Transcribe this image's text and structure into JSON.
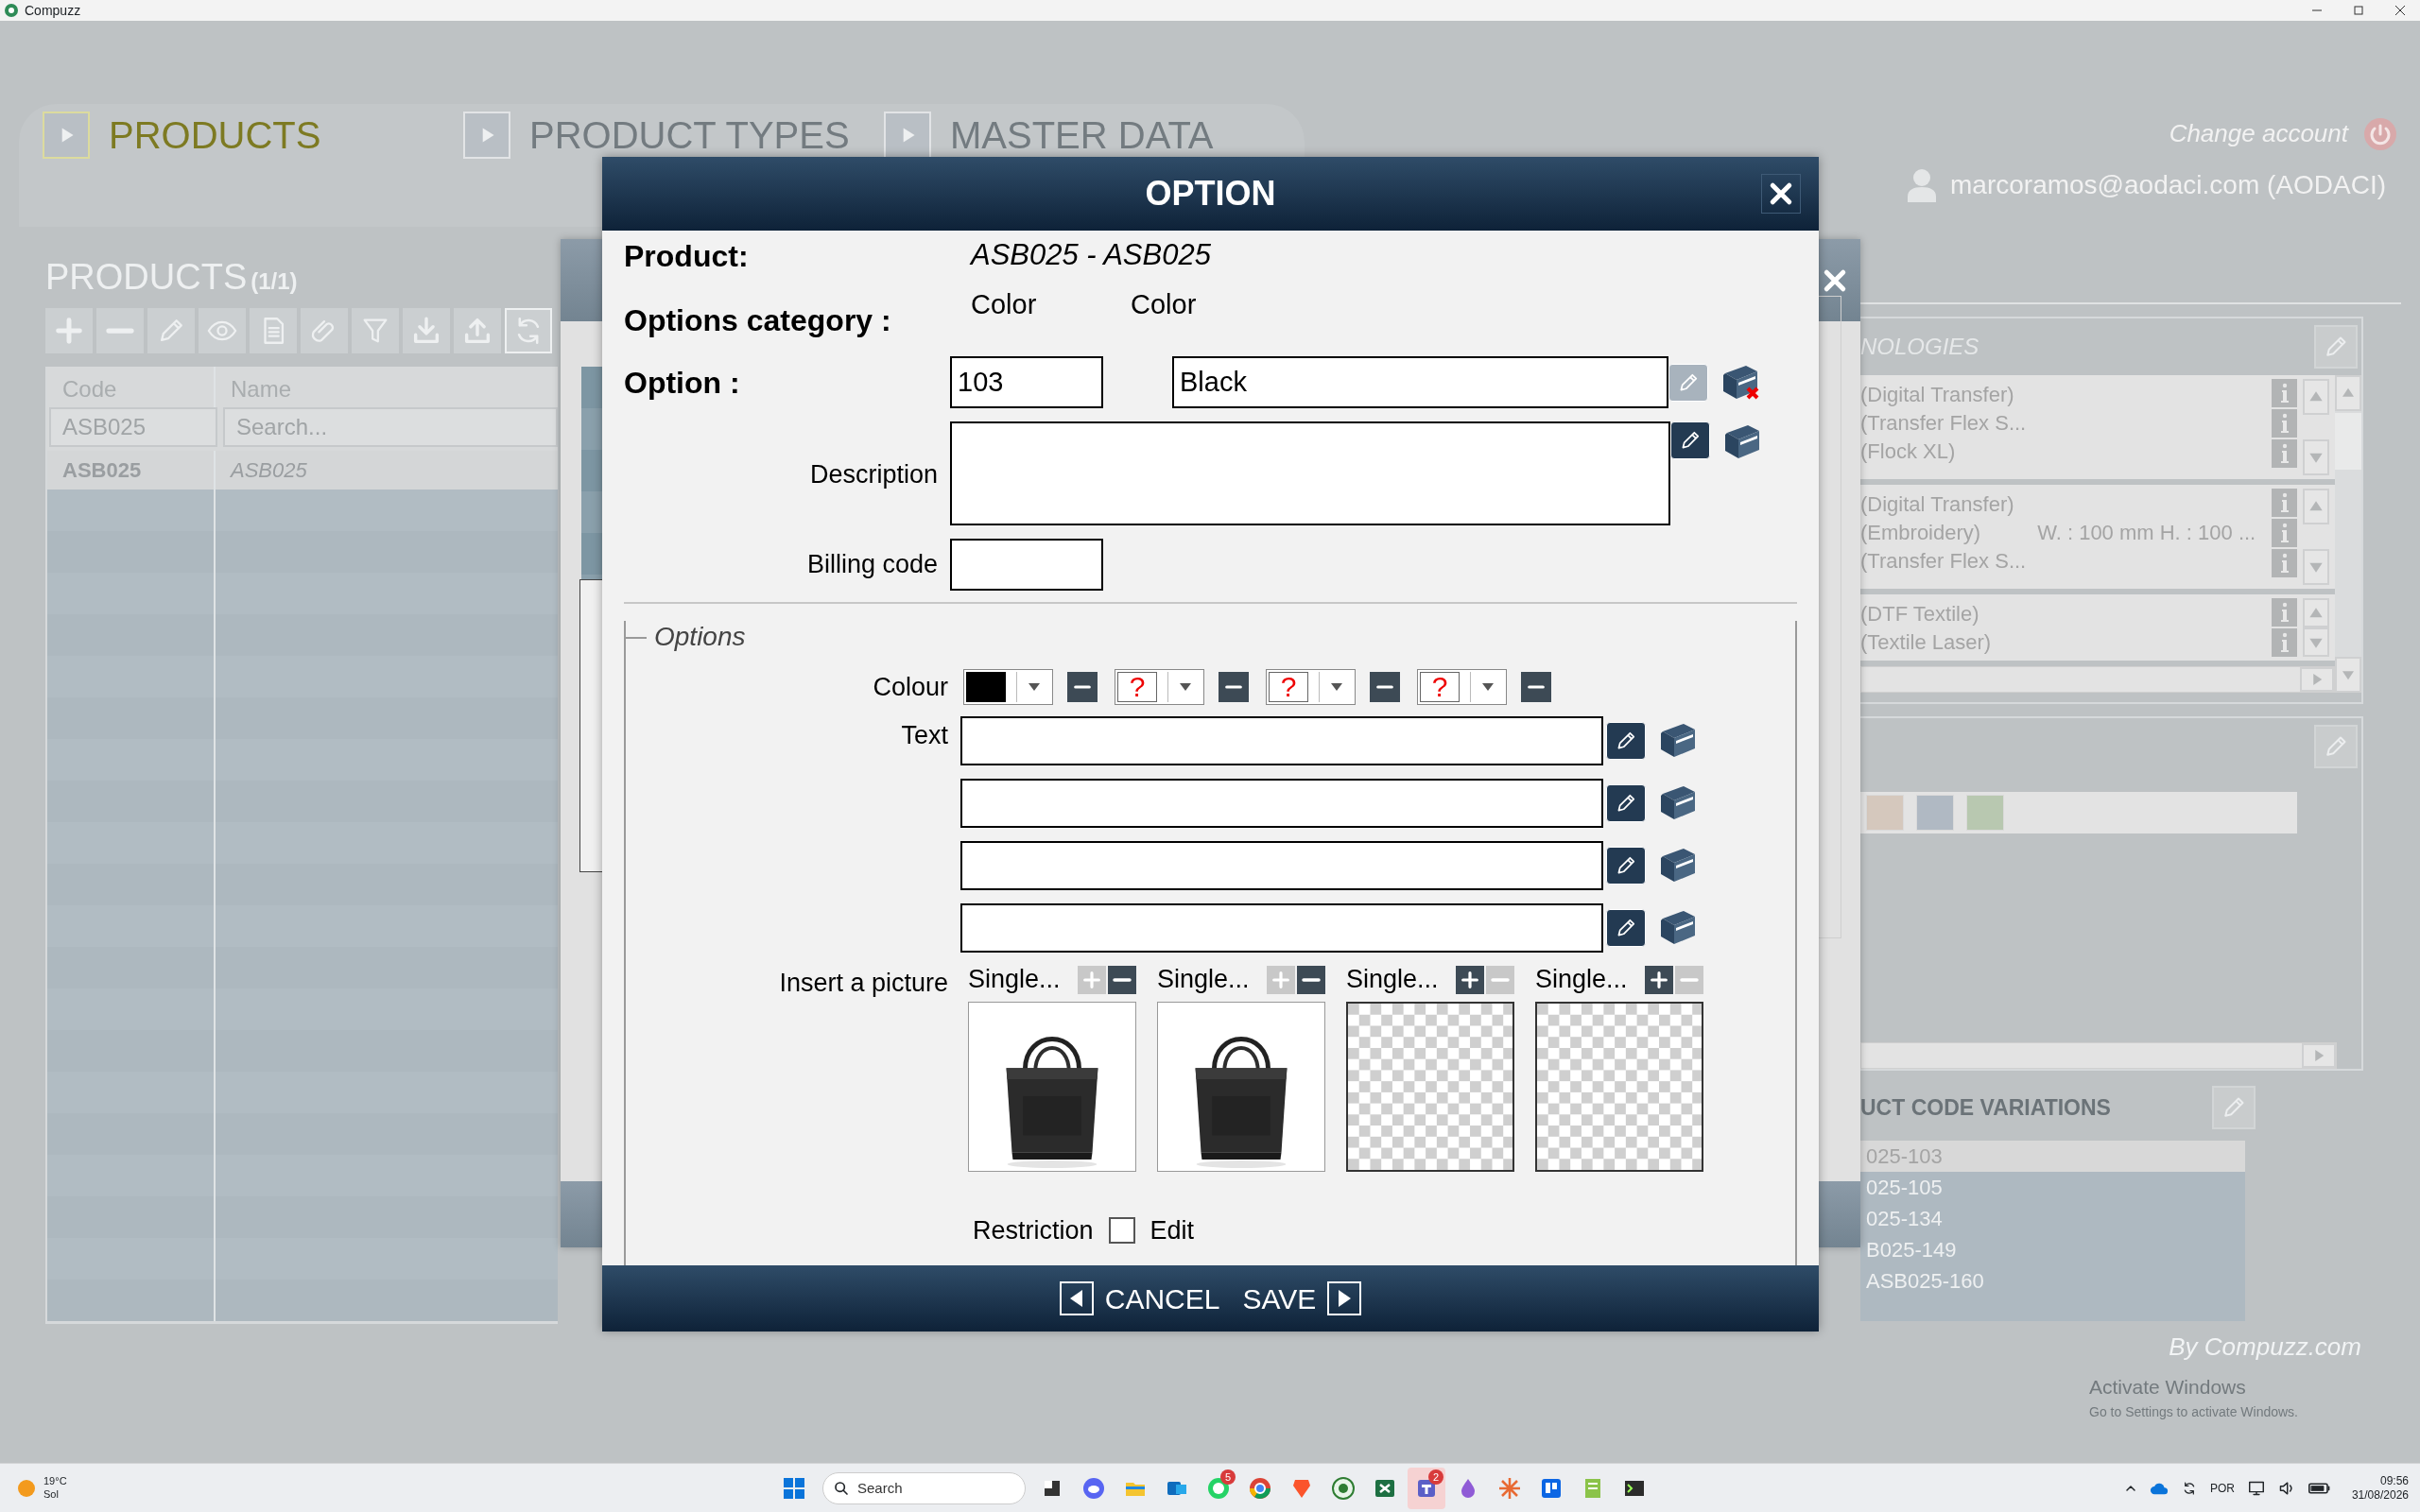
{
  "window": {
    "title": "Compuzz"
  },
  "nav_tabs": [
    {
      "label": "PRODUCTS",
      "selected": true
    },
    {
      "label": "PRODUCT TYPES",
      "selected": false
    },
    {
      "label": "MASTER DATA",
      "selected": false
    }
  ],
  "account": {
    "change_label": "Change account",
    "user": "marcoramos@aodaci.com (AODACI)"
  },
  "products_panel": {
    "title": "PRODUCTS",
    "count": "(1/1)",
    "toolbar": [
      {
        "kind": "add",
        "focused": false
      },
      {
        "kind": "remove",
        "focused": false
      },
      {
        "kind": "edit",
        "focused": false
      },
      {
        "kind": "view",
        "focused": false
      },
      {
        "kind": "document",
        "focused": false
      },
      {
        "kind": "attach",
        "focused": false
      },
      {
        "kind": "filter",
        "focused": false
      },
      {
        "kind": "download",
        "focused": false
      },
      {
        "kind": "upload",
        "focused": false
      },
      {
        "kind": "refresh",
        "focused": true
      }
    ],
    "columns": [
      "Code",
      "Name"
    ],
    "filters": [
      {
        "value": "ASB025"
      },
      {
        "placeholder": "Search..."
      }
    ],
    "rows": [
      {
        "code": "ASB025",
        "name": "ASB025"
      }
    ]
  },
  "technologies_panel": {
    "title": "NOLOGIES",
    "groups": [
      {
        "lines": [
          {
            "text": "(Digital Transfer)"
          },
          {
            "text": "(Transfer Flex S..."
          },
          {
            "text": "(Flock XL)"
          }
        ]
      },
      {
        "lines": [
          {
            "text": "(Digital Transfer)"
          },
          {
            "text": "(Embroidery)",
            "size": "W. : 100 mm H. : 100 ..."
          },
          {
            "text": "(Transfer Flex S..."
          }
        ]
      },
      {
        "lines": [
          {
            "text": "(DTF Textile)"
          },
          {
            "text": "(Textile Laser)"
          }
        ]
      }
    ]
  },
  "colors_panel": {
    "swatches": [
      {
        "color": "#d5c8bd"
      },
      {
        "color": "#b0b9c3"
      },
      {
        "color": "#b8c8b0"
      }
    ]
  },
  "variations_panel": {
    "title": "UCT CODE VARIATIONS",
    "rows": [
      {
        "code": "025-103",
        "selected": true
      },
      {
        "code": "025-105",
        "selected": false
      },
      {
        "code": "025-134",
        "selected": false
      },
      {
        "code": "B025-149",
        "selected": false
      },
      {
        "code": "ASB025-160",
        "selected": false
      }
    ]
  },
  "footer": {
    "brand": "By Compuzz.com"
  },
  "activation_notice": {
    "title": "Activate Windows",
    "text": "Go to Settings to activate Windows."
  },
  "dialog": {
    "title": "OPTION",
    "product_label": "Product:",
    "product_value": "ASB025 - ASB025",
    "category_label": "Options category :",
    "category_values": [
      "Color",
      "Color"
    ],
    "option_label": "Option :",
    "option_code": "103",
    "option_name": "Black",
    "option_edit_disabled": true,
    "option_flagged": true,
    "description_label": "Description",
    "description_edit_disabled": false,
    "description_flagged": false,
    "billing_label": "Billing code",
    "options_legend": "Options",
    "colour_label": "Colour",
    "colour_slots": [
      {
        "kind": "swatch",
        "color": "#000000"
      },
      {
        "kind": "unknown",
        "symbol": "?"
      },
      {
        "kind": "unknown",
        "symbol": "?"
      },
      {
        "kind": "unknown",
        "symbol": "?"
      }
    ],
    "text_label": "Text",
    "text_rows": [
      {
        "edit_disabled": false
      },
      {
        "edit_disabled": false
      },
      {
        "edit_disabled": false
      },
      {
        "edit_disabled": false
      }
    ],
    "picture_label": "Insert a picture",
    "pictures": [
      {
        "label": "Single...",
        "kind": "picture",
        "add_enabled": false,
        "remove_enabled": true
      },
      {
        "label": "Single...",
        "kind": "picture",
        "add_enabled": false,
        "remove_enabled": true
      },
      {
        "label": "Single...",
        "kind": "empty",
        "add_enabled": true,
        "remove_enabled": false
      },
      {
        "label": "Single...",
        "kind": "empty",
        "add_enabled": true,
        "remove_enabled": false
      }
    ],
    "restriction_label": "Restriction",
    "restriction_checked": false,
    "edit_label": "Edit",
    "buttons": [
      {
        "label": "CANCEL",
        "kind": "back"
      },
      {
        "label": "SAVE",
        "kind": "forward"
      }
    ]
  },
  "taskbar": {
    "temperature": "19°C",
    "weather": "Sol",
    "search_placeholder": "Search",
    "apps": [
      {
        "active": false
      },
      {
        "active": false
      },
      {
        "active": false
      },
      {
        "active": false
      },
      {
        "active": false,
        "badge": "5"
      },
      {
        "active": false
      },
      {
        "active": false
      },
      {
        "active": false
      },
      {
        "active": false
      },
      {
        "active": true,
        "badge": "2"
      },
      {
        "active": false
      },
      {
        "active": false
      },
      {
        "active": false
      },
      {
        "active": false
      },
      {
        "active": false
      }
    ],
    "language": "POR",
    "time": "09:56",
    "date": "31/08/2026"
  }
}
